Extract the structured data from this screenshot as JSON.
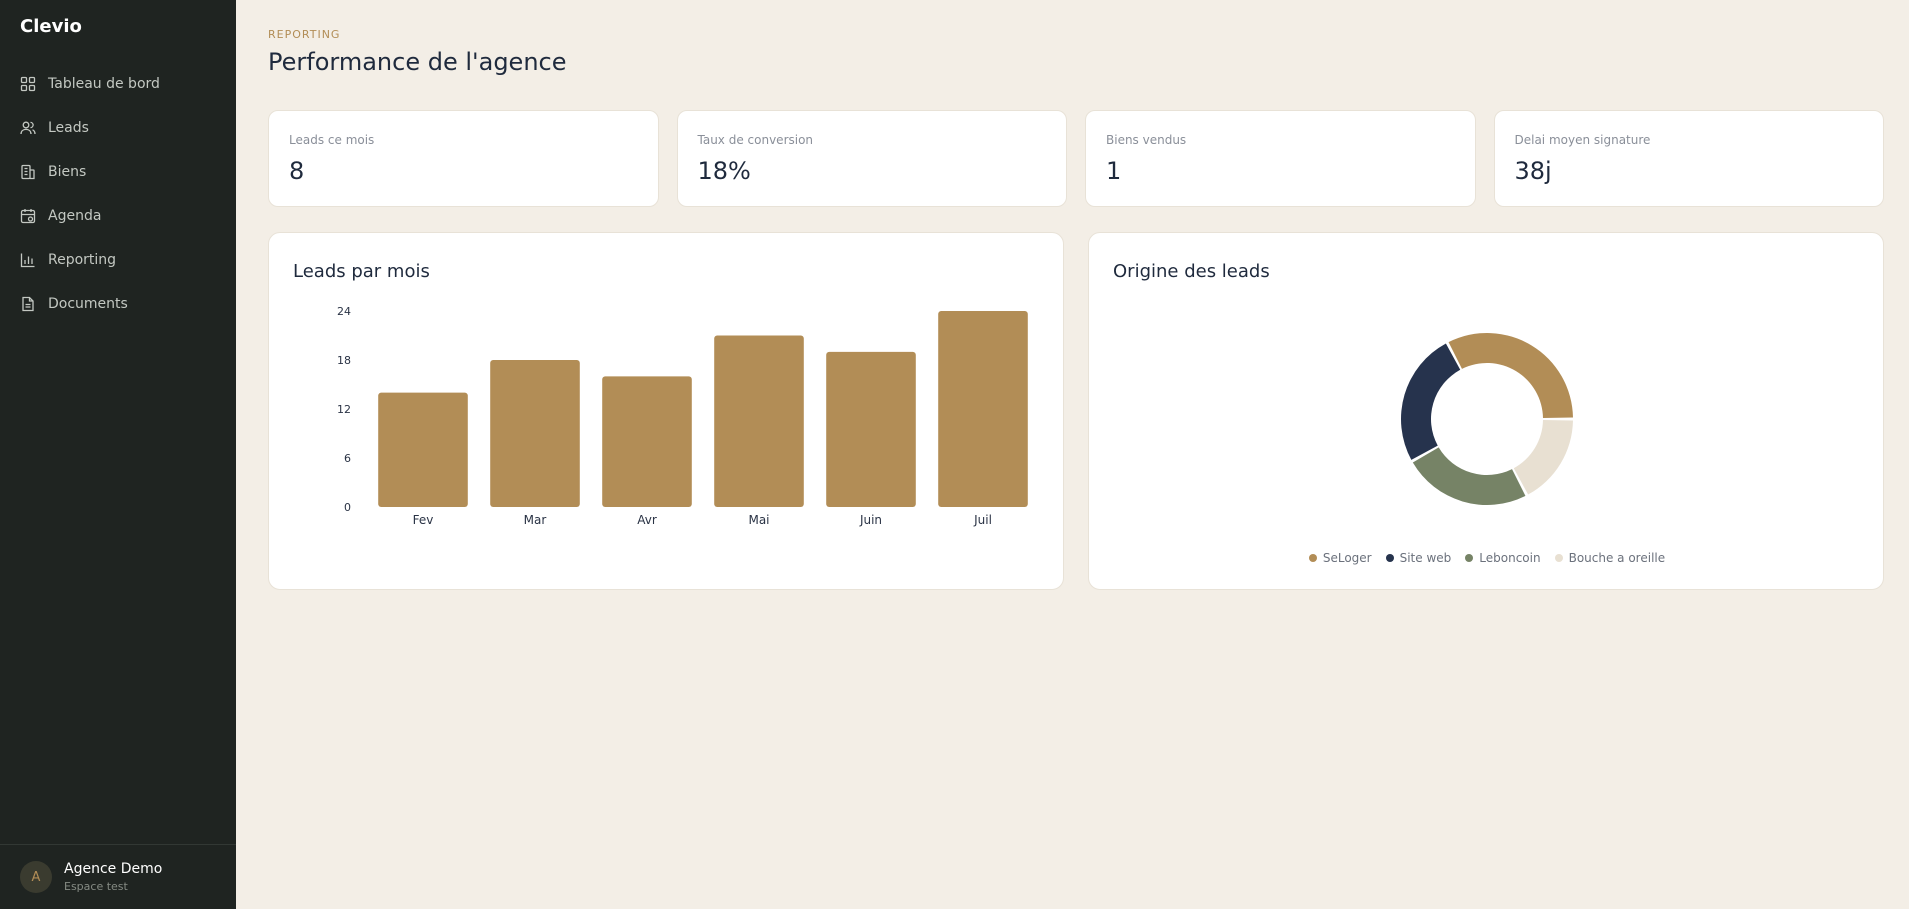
{
  "app": {
    "name": "Clevio"
  },
  "sidebar": {
    "items": [
      {
        "label": "Tableau de bord",
        "icon": "grid-icon"
      },
      {
        "label": "Leads",
        "icon": "users-icon"
      },
      {
        "label": "Biens",
        "icon": "building-icon"
      },
      {
        "label": "Agenda",
        "icon": "calendar-icon"
      },
      {
        "label": "Reporting",
        "icon": "bar-chart-icon"
      },
      {
        "label": "Documents",
        "icon": "document-icon"
      }
    ],
    "user": {
      "initial": "A",
      "name": "Agence Demo",
      "subtitle": "Espace test"
    }
  },
  "header": {
    "eyebrow": "REPORTING",
    "title": "Performance de l'agence"
  },
  "kpis": [
    {
      "label": "Leads ce mois",
      "value": "8"
    },
    {
      "label": "Taux de conversion",
      "value": "18%"
    },
    {
      "label": "Biens vendus",
      "value": "1"
    },
    {
      "label": "Delai moyen signature",
      "value": "38j"
    }
  ],
  "colors": {
    "gold": "#b28d56",
    "navy": "#26334d",
    "green": "#768366",
    "beige": "#e8e0d2",
    "sidebar": "#1f2421",
    "background": "#f3eee6"
  },
  "chart_data": [
    {
      "type": "bar",
      "title": "Leads par mois",
      "categories": [
        "Fev",
        "Mar",
        "Avr",
        "Mai",
        "Juin",
        "Juil"
      ],
      "values": [
        14,
        18,
        16,
        21,
        19,
        24
      ],
      "yticks": [
        0,
        6,
        12,
        18,
        24
      ],
      "ylim": [
        0,
        24
      ],
      "color": "#b28d56",
      "grid": false
    },
    {
      "type": "pie",
      "title": "Origine des leads",
      "labels": [
        "SeLoger",
        "Site web",
        "Leboncoin",
        "Bouche a oreille"
      ],
      "values": [
        32,
        25,
        24,
        17
      ],
      "colors": [
        "#b28d56",
        "#26334d",
        "#768366",
        "#e8e0d2"
      ],
      "donut": true,
      "legend": "bottom"
    }
  ]
}
